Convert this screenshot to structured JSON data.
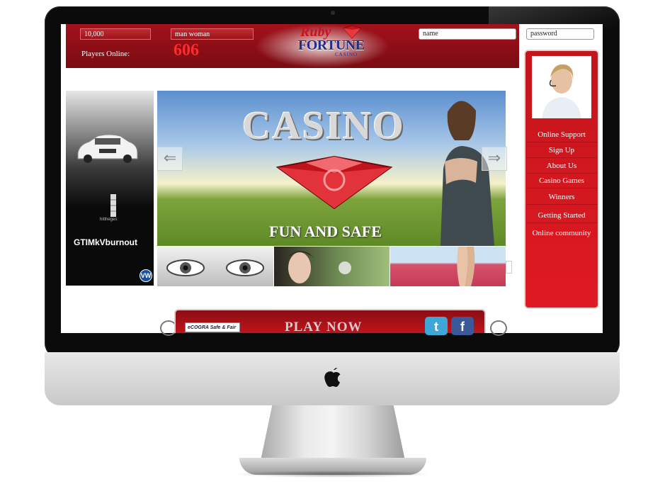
{
  "header": {
    "credit_value": "10,000",
    "select_value": "man woman",
    "name_placeholder": "name",
    "password_placeholder": "password",
    "players_online_label": "Players Online:",
    "players_online_count": "606"
  },
  "logo": {
    "line1": "Ruby",
    "line2": "FORTUNE",
    "line3": "CASINO"
  },
  "sidebar": {
    "items": [
      {
        "label": "Online Support"
      },
      {
        "label": "Sign Up"
      },
      {
        "label": "About Us"
      },
      {
        "label": "Casino Games"
      },
      {
        "label": "Winners"
      },
      {
        "label": "Getting Started"
      },
      {
        "label": "Online community"
      }
    ]
  },
  "ad": {
    "tagline_small": "hittheges",
    "headline": "GTIMkVburnout",
    "badge": "VW"
  },
  "hero": {
    "title": "CASINO",
    "subtitle": "FUN AND SAFE",
    "prev_icon": "arrow-left-icon",
    "next_icon": "arrow-right-icon"
  },
  "footer": {
    "play_label": "PLAY NOW",
    "ecogra_label": "eCOGRA Safe & Fair",
    "twitter_glyph": "t",
    "facebook_glyph": "f"
  },
  "colors": {
    "brand_red": "#c4141c",
    "logo_blue": "#1f2e86",
    "count_red": "#ff2b2b"
  }
}
